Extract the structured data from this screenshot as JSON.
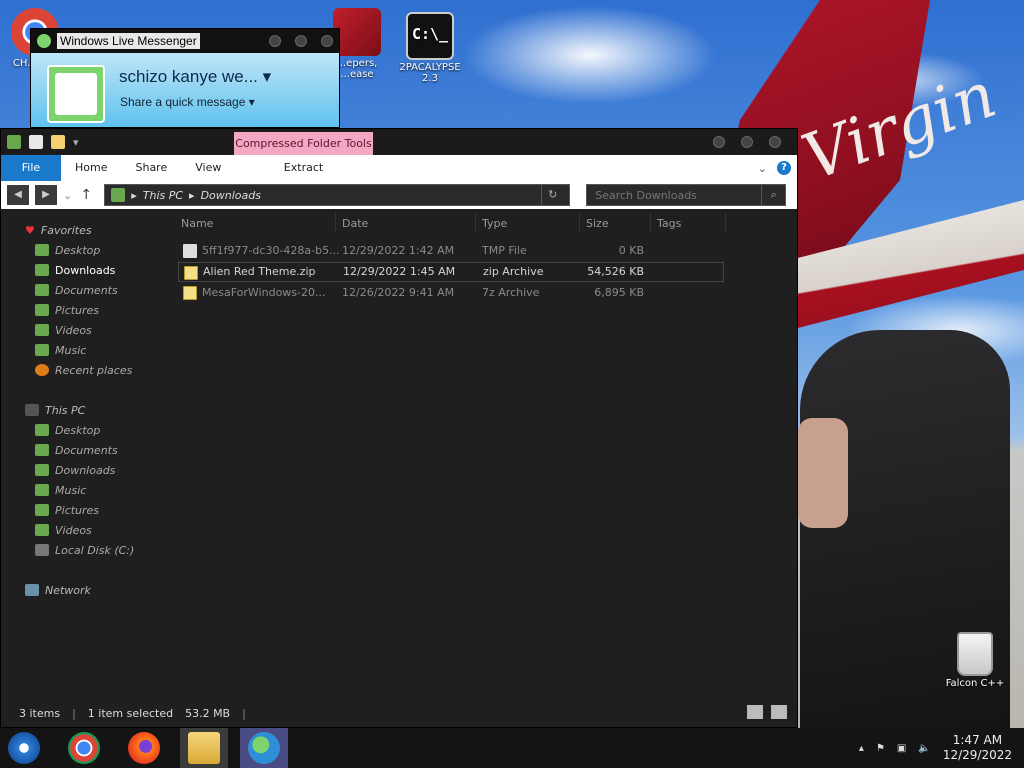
{
  "desktop": {
    "icons": [
      {
        "label": "CH... D...",
        "icon": "chrome-icon"
      },
      {
        "label": "...epers, ...ease",
        "icon": "app-icon"
      },
      {
        "label": "2PACALYPSE 2.3",
        "icon": "cmd-icon"
      },
      {
        "label": "Falcon C++",
        "icon": "recycle-bin-icon"
      }
    ],
    "wallpaper_text": "Virgin"
  },
  "messenger": {
    "title": "Windows Live Messenger",
    "display_name": "schizo kanye we...",
    "quick_message": "Share a quick message"
  },
  "explorer": {
    "context_tab": "Compressed Folder Tools",
    "ribbon_tabs": [
      "File",
      "Home",
      "Share",
      "View"
    ],
    "extract_tab": "Extract",
    "breadcrumb": [
      "This PC",
      "Downloads"
    ],
    "search_placeholder": "Search Downloads",
    "columns": [
      "Name",
      "Date",
      "Type",
      "Size",
      "Tags"
    ],
    "files": [
      {
        "name": "5ff1f977-dc30-428a-b5...",
        "date": "12/29/2022 1:42 AM",
        "type": "TMP File",
        "size": "0 KB",
        "icon": "file-icon"
      },
      {
        "name": "Alien Red Theme.zip",
        "date": "12/29/2022 1:45 AM",
        "type": "zip Archive",
        "size": "54,526 KB",
        "icon": "zip-icon"
      },
      {
        "name": "MesaForWindows-20...",
        "date": "12/26/2022 9:41 AM",
        "type": "7z Archive",
        "size": "6,895 KB",
        "icon": "7z-icon"
      }
    ],
    "nav": {
      "favorites_header": "Favorites",
      "favorites": [
        "Desktop",
        "Downloads",
        "Documents",
        "Pictures",
        "Videos",
        "Music",
        "Recent places"
      ],
      "thispc_header": "This PC",
      "thispc": [
        "Desktop",
        "Documents",
        "Downloads",
        "Music",
        "Pictures",
        "Videos",
        "Local Disk (C:)"
      ],
      "network": "Network"
    },
    "status": {
      "count": "3 items",
      "selected": "1 item selected",
      "size": "53.2 MB"
    }
  },
  "taskbar": {
    "time": "1:47 AM",
    "date": "12/29/2022"
  },
  "colors": {
    "accent": "#1979ca",
    "context_tab": "#f4a7c2",
    "dark_bg": "#1f1f1f"
  }
}
